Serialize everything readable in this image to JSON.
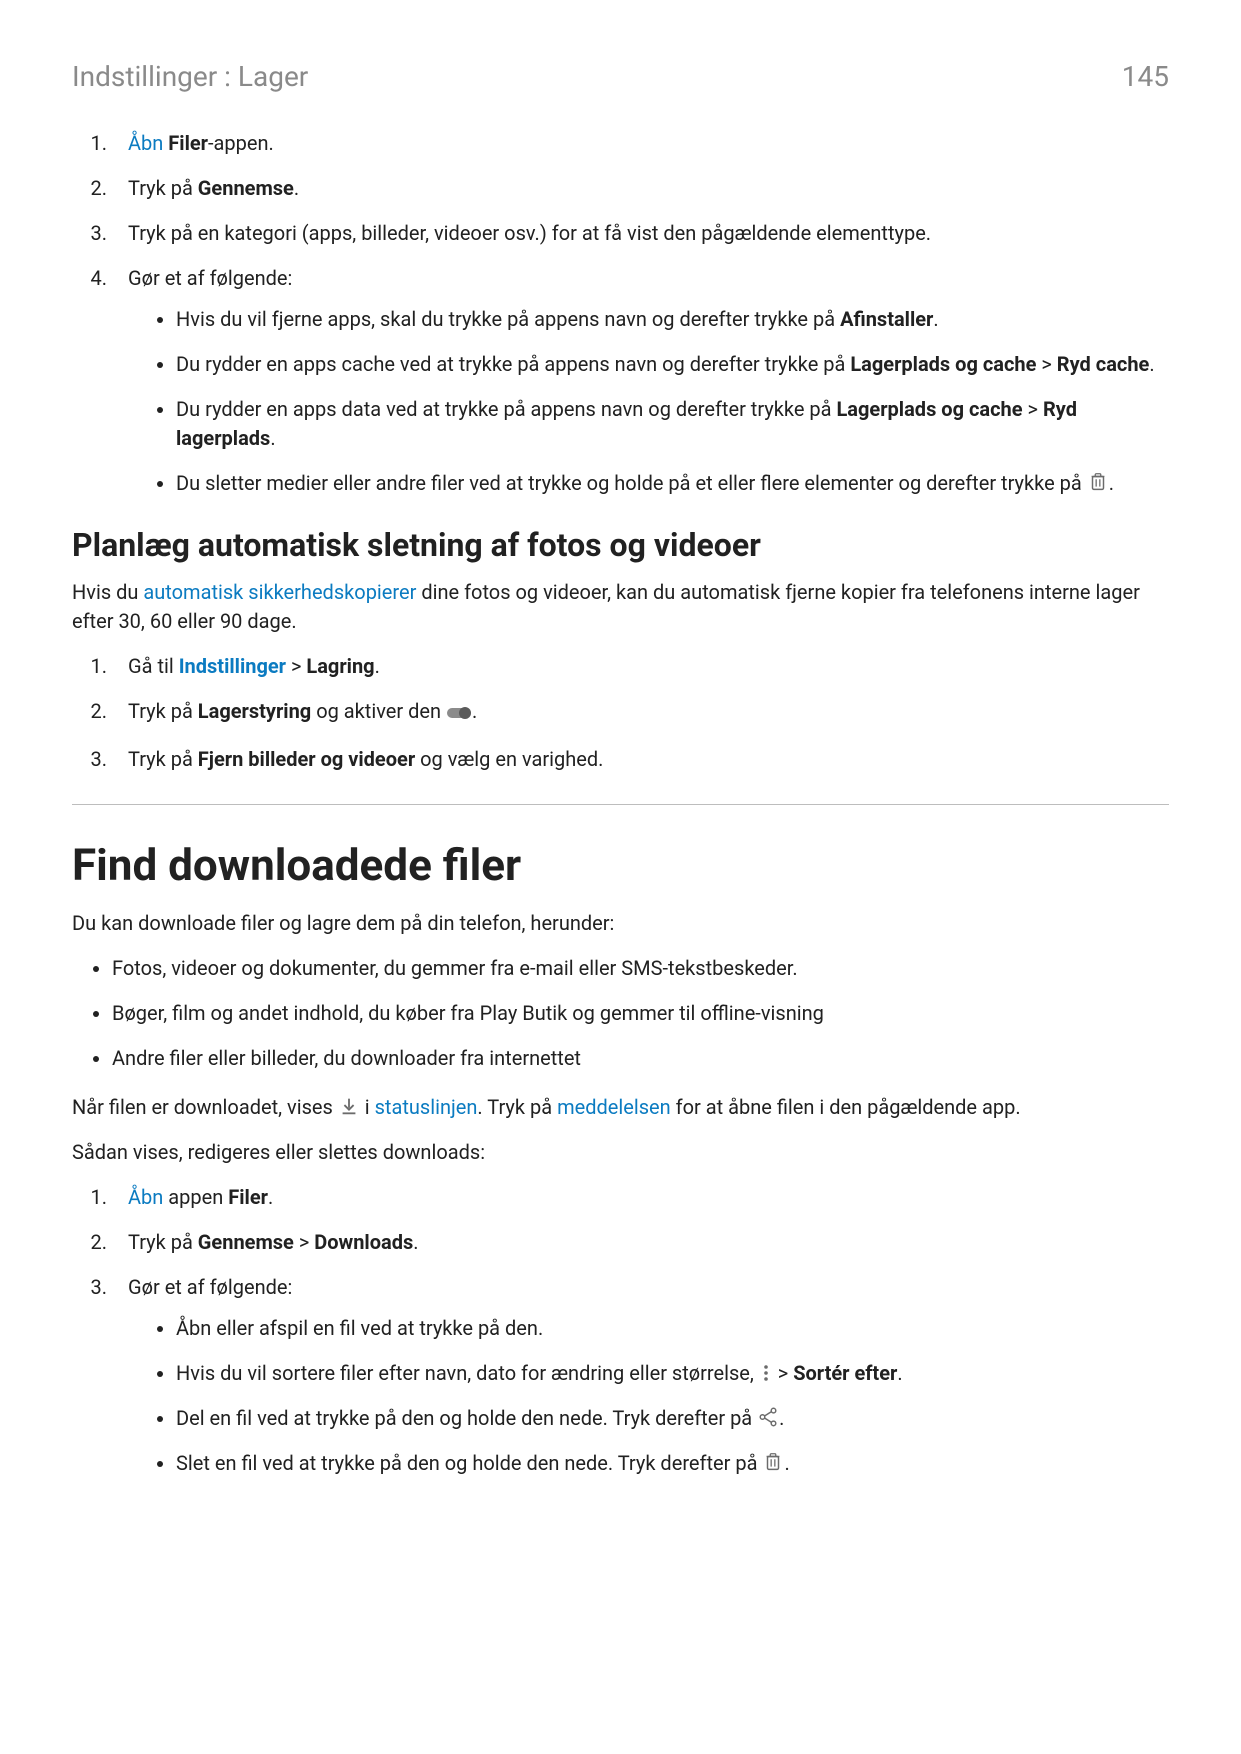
{
  "header": {
    "breadcrumb": "Indstillinger : Lager",
    "page_number": "145"
  },
  "top_list": {
    "item1_pre": "Åbn",
    "item1_link": "Åbn",
    "item1_b": "Filer",
    "item1_suffix": "-appen.",
    "item2_a": "Tryk på ",
    "item2_b": "Gennemse",
    "item2_c": ".",
    "item3": "Tryk på en kategori (apps, billeder, videoer osv.) for at få vist den pågældende elementtype.",
    "item4": "Gør et af følgende:",
    "sub1_a": "Hvis du vil fjerne apps, skal du trykke på appens navn og derefter trykke på ",
    "sub1_b": "Afinstaller",
    "sub1_c": ".",
    "sub2_a": "Du rydder en apps cache ved at trykke på appens navn og derefter trykke på ",
    "sub2_b": "Lagerplads og cache",
    "sub2_c": " > ",
    "sub2_d": "Ryd cache",
    "sub2_e": ".",
    "sub3_a": "Du rydder en apps data ved at trykke på appens navn og derefter trykke på ",
    "sub3_b": "Lagerplads og cache",
    "sub3_c": " > ",
    "sub3_d": "Ryd lagerplads",
    "sub3_e": ".",
    "sub4_a": "Du sletter medier eller andre filer ved at trykke og holde på et eller flere elementer og derefter trykke på ",
    "sub4_b": "."
  },
  "section2": {
    "heading": "Planlæg automatisk sletning af fotos og videoer",
    "intro_a": "Hvis du ",
    "intro_link": "automatisk sikkerhedskopierer",
    "intro_b": " dine fotos og videoer, kan du automatisk fjerne kopier fra telefonens interne lager efter 30, 60 eller 90 dage.",
    "s1_a": "Gå til ",
    "s1_link": "Indstillinger",
    "s1_b": " > ",
    "s1_c": "Lagring",
    "s1_d": ".",
    "s2_a": "Tryk på ",
    "s2_b": "Lagerstyring",
    "s2_c": " og aktiver den ",
    "s2_d": ".",
    "s3_a": "Tryk på ",
    "s3_b": "Fjern billeder og videoer",
    "s3_c": " og vælg en varighed."
  },
  "section3": {
    "heading": "Find downloadede filer",
    "intro": "Du kan downloade filer og lagre dem på din telefon, herunder:",
    "b1": "Fotos, videoer og dokumenter, du gemmer fra e-mail eller SMS-tekstbeskeder.",
    "b2": "Bøger, film og andet indhold, du køber fra Play Butik og gemmer til offline-visning",
    "b3": "Andre filer eller billeder, du downloader fra internettet",
    "p2_a": "Når filen er downloadet, vises ",
    "p2_b": " i ",
    "p2_link1": "statuslinjen",
    "p2_c": ". Tryk på ",
    "p2_link2": "meddelelsen",
    "p2_d": " for at åbne filen i den pågældende app.",
    "p3": "Sådan vises, redigeres eller slettes downloads:",
    "o1_link": "Åbn",
    "o1_a": " appen ",
    "o1_b": "Filer",
    "o1_c": ".",
    "o2_a": "Tryk på ",
    "o2_b": "Gennemse",
    "o2_c": " > ",
    "o2_d": "Downloads",
    "o2_e": ".",
    "o3": "Gør et af følgende:",
    "sb1": "Åbn eller afspil en fil ved at trykke på den.",
    "sb2_a": "Hvis du vil sortere filer efter navn, dato for ændring eller størrelse, ",
    "sb2_b": " > ",
    "sb2_c": "Sortér efter",
    "sb2_d": ".",
    "sb3_a": "Del en fil ved at trykke på den og holde den nede. Tryk derefter på ",
    "sb3_b": ".",
    "sb4_a": "Slet en fil ved at trykke på den og holde den nede. Tryk derefter på ",
    "sb4_b": "."
  }
}
